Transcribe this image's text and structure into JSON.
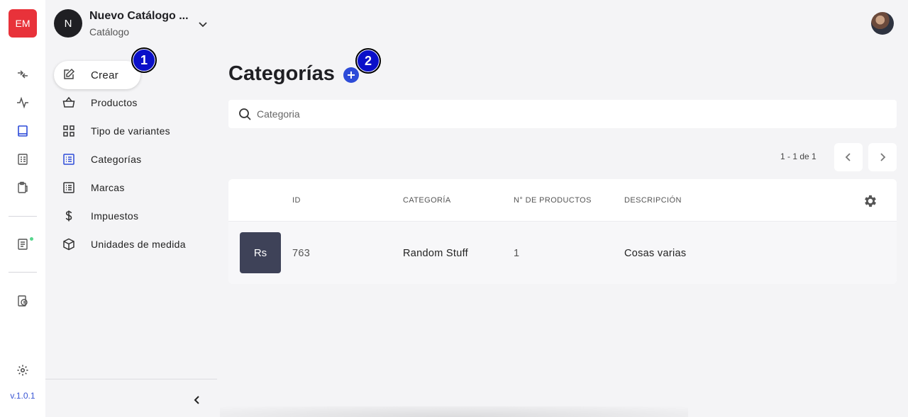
{
  "rail": {
    "brand": "EM",
    "version": "v.1.0.1"
  },
  "catalog": {
    "avatar_letter": "N",
    "name": "Nuevo Catálogo ...",
    "subtitle": "Catálogo"
  },
  "sidebar": {
    "create_label": "Crear",
    "items": [
      {
        "label": "Productos"
      },
      {
        "label": "Tipo de variantes"
      },
      {
        "label": "Categorías"
      },
      {
        "label": "Marcas"
      },
      {
        "label": "Impuestos"
      },
      {
        "label": "Unidades de medida"
      }
    ]
  },
  "badges": [
    "1",
    "2"
  ],
  "main": {
    "title": "Categorías",
    "search_placeholder": "Categoria",
    "pagination": "1 - 1 de 1",
    "columns": [
      "ID",
      "CATEGORÍA",
      "N° DE PRODUCTOS",
      "DESCRIPCIÓN"
    ],
    "rows": [
      {
        "thumb": "Rs",
        "id": "763",
        "category": "Random Stuff",
        "products": "1",
        "description": "Cosas varias"
      }
    ]
  },
  "colors": {
    "brand": "#e8323a",
    "accent": "#2d4bd8",
    "badge": "#0a10c9"
  }
}
